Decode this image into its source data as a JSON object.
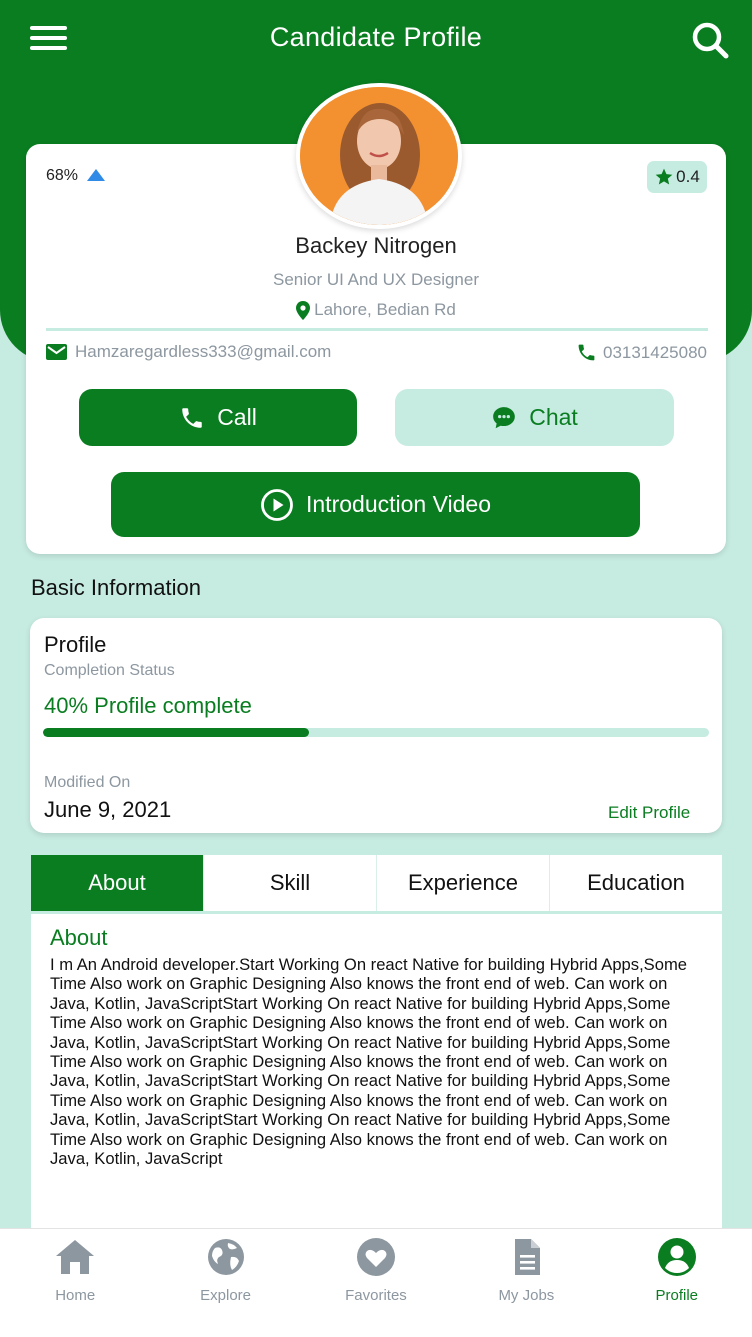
{
  "header": {
    "title": "Candidate Profile"
  },
  "profile": {
    "progress_percent": "68%",
    "rating": "0.4",
    "name": "Backey Nitrogen",
    "job_title": "Senior UI And UX Designer",
    "location": "Lahore, Bedian Rd",
    "email": "Hamzaregardless333@gmail.com",
    "phone": "03131425080",
    "call_label": "Call",
    "chat_label": "Chat",
    "video_label": "Introduction Video"
  },
  "basic_info": {
    "section_title": "Basic Information",
    "card_title": "Profile",
    "card_subtitle": "Completion Status",
    "completion_text": "40% Profile complete",
    "completion_fraction": 0.4,
    "modified_label": "Modified On",
    "modified_date": "June 9, 2021",
    "edit_label": "Edit Profile"
  },
  "tabs": {
    "items": [
      {
        "label": "About",
        "active": true
      },
      {
        "label": "Skill",
        "active": false
      },
      {
        "label": "Experience",
        "active": false
      },
      {
        "label": "Education",
        "active": false
      }
    ]
  },
  "about": {
    "title": "About",
    "text": "I m An Android developer.Start Working On react Native for building Hybrid Apps,Some Time Also work on Graphic Designing Also knows the front end of web. Can work on Java, Kotlin, JavaScriptStart Working On react Native for building Hybrid Apps,Some Time Also work on Graphic Designing Also knows the front end of web. Can work on Java, Kotlin, JavaScriptStart Working On react Native for building Hybrid Apps,Some Time Also work on Graphic Designing Also knows the front end of web. Can work on Java, Kotlin, JavaScriptStart Working On react Native for building Hybrid Apps,Some Time Also work on Graphic Designing Also knows the front end of web. Can work on Java, Kotlin, JavaScriptStart Working On react Native for building Hybrid Apps,Some Time Also work on Graphic Designing Also knows the front end of web. Can work on Java, Kotlin, JavaScript"
  },
  "bottom_nav": {
    "items": [
      {
        "label": "Home",
        "icon": "home-icon",
        "active": false
      },
      {
        "label": "Explore",
        "icon": "globe-icon",
        "active": false
      },
      {
        "label": "Favorites",
        "icon": "heart-icon",
        "active": false
      },
      {
        "label": "My Jobs",
        "icon": "document-icon",
        "active": false
      },
      {
        "label": "Profile",
        "icon": "user-circle-icon",
        "active": true
      }
    ]
  },
  "colors": {
    "primary": "#0a7d21",
    "accent_light": "#c6ebe1",
    "muted_text": "#8d97a0",
    "up_arrow": "#2f8be6"
  }
}
